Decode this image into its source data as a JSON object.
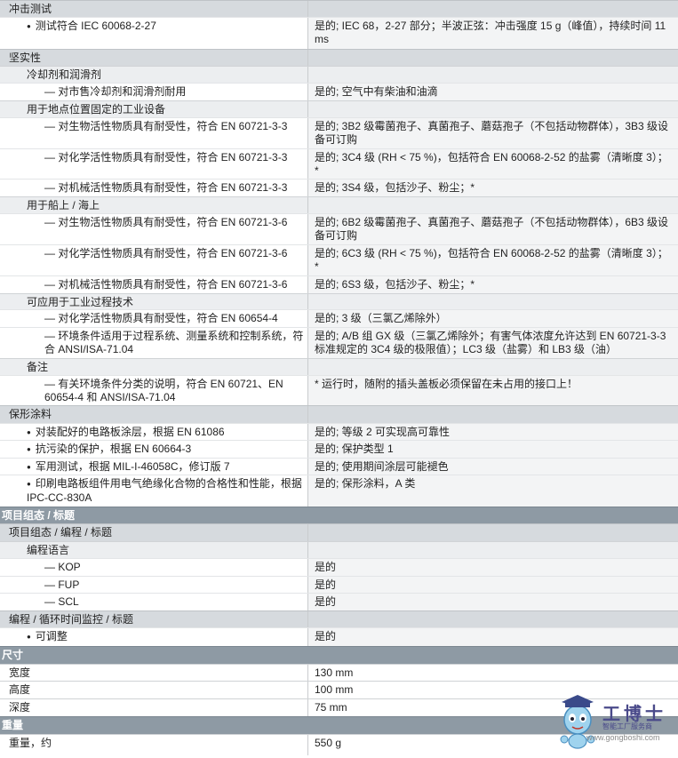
{
  "rows": [
    {
      "kind": "sec",
      "label": "冲击测试",
      "value": ""
    },
    {
      "kind": "item",
      "indent": "bul",
      "label": "测试符合 IEC 60068-2-27",
      "value": "是的; IEC 68，2-27 部分；半波正弦：冲击强度 15 g（峰值），持续时间 11 ms"
    },
    {
      "kind": "sec",
      "label": "坚实性",
      "value": ""
    },
    {
      "kind": "sub",
      "indent": "t1",
      "label": "冷却剂和润滑剂",
      "value": ""
    },
    {
      "kind": "item",
      "indent": "t2",
      "label": "— 对市售冷却剂和润滑剂耐用",
      "value": "是的; 空气中有柴油和油滴"
    },
    {
      "kind": "sub",
      "indent": "t1",
      "label": "用于地点位置固定的工业设备",
      "value": ""
    },
    {
      "kind": "item",
      "indent": "t2",
      "label": "— 对生物活性物质具有耐受性，符合 EN 60721-3-3",
      "value": "是的; 3B2 级霉菌孢子、真菌孢子、蘑菇孢子（不包括动物群体），3B3 级设备可订购"
    },
    {
      "kind": "item",
      "indent": "t2",
      "label": "— 对化学活性物质具有耐受性，符合 EN 60721-3-3",
      "value": "是的; 3C4 级 (RH < 75 %)，包括符合 EN 60068-2-52 的盐雾（清晰度 3）；*"
    },
    {
      "kind": "item",
      "indent": "t2",
      "label": "— 对机械活性物质具有耐受性，符合 EN 60721-3-3",
      "value": "是的; 3S4 级，包括沙子、粉尘；*"
    },
    {
      "kind": "sub",
      "indent": "t1",
      "label": "用于船上 / 海上",
      "value": ""
    },
    {
      "kind": "item",
      "indent": "t2",
      "label": "— 对生物活性物质具有耐受性，符合 EN 60721-3-6",
      "value": "是的; 6B2 级霉菌孢子、真菌孢子、蘑菇孢子（不包括动物群体），6B3 级设备可订购"
    },
    {
      "kind": "item",
      "indent": "t2",
      "label": "— 对化学活性物质具有耐受性，符合 EN 60721-3-6",
      "value": "是的; 6C3 级 (RH < 75 %)，包括符合 EN 60068-2-52 的盐雾（清晰度 3）；*"
    },
    {
      "kind": "item",
      "indent": "t2",
      "label": "— 对机械活性物质具有耐受性，符合 EN 60721-3-6",
      "value": "是的; 6S3 级，包括沙子、粉尘；*"
    },
    {
      "kind": "sub",
      "indent": "t1",
      "label": "可应用于工业过程技术",
      "value": ""
    },
    {
      "kind": "item",
      "indent": "t2",
      "label": "— 对化学活性物质具有耐受性，符合 EN 60654-4",
      "value": "是的; 3 级（三氯乙烯除外）"
    },
    {
      "kind": "item",
      "indent": "t2",
      "label": "— 环境条件适用于过程系统、测量系统和控制系统，符合 ANSI/ISA-71.04",
      "value": "是的; A/B 组 GX 级（三氯乙烯除外；有害气体浓度允许达到 EN 60721-3-3 标准规定的 3C4 级的极限值）；LC3 级（盐雾）和 LB3 级（油）"
    },
    {
      "kind": "sub",
      "indent": "t1",
      "label": "备注",
      "value": ""
    },
    {
      "kind": "item",
      "indent": "t2",
      "label": "— 有关环境条件分类的说明，符合 EN 60721、EN 60654-4 和 ANSI/ISA-71.04",
      "value": "* 运行时，随附的插头盖板必须保留在未占用的接口上！"
    },
    {
      "kind": "sec",
      "label": "保形涂料",
      "value": ""
    },
    {
      "kind": "item",
      "indent": "bul",
      "label": "对装配好的电路板涂层，根据 EN 61086",
      "value": "是的; 等级 2 可实现高可靠性"
    },
    {
      "kind": "item",
      "indent": "bul",
      "label": "抗污染的保护，根据 EN 60664-3",
      "value": "是的; 保护类型 1"
    },
    {
      "kind": "item",
      "indent": "bul",
      "label": "军用测试，根据 MIL-I-46058C，修订版 7",
      "value": "是的; 使用期间涂层可能褪色"
    },
    {
      "kind": "item",
      "indent": "bul",
      "label": "印刷电路板组件用电气绝缘化合物的合格性和性能，根据 IPC-CC-830A",
      "value": "是的; 保形涂料，A 类"
    },
    {
      "kind": "bar",
      "label": "项目组态 / 标题",
      "value": ""
    },
    {
      "kind": "sec",
      "label": "项目组态 / 编程 / 标题",
      "value": ""
    },
    {
      "kind": "sub",
      "indent": "t1",
      "label": "编程语言",
      "value": ""
    },
    {
      "kind": "item",
      "indent": "t2",
      "label": "— KOP",
      "value": "是的"
    },
    {
      "kind": "item",
      "indent": "t2",
      "label": "— FUP",
      "value": "是的"
    },
    {
      "kind": "item",
      "indent": "t2",
      "label": "— SCL",
      "value": "是的"
    },
    {
      "kind": "sec",
      "label": "编程 / 循环时间监控 / 标题",
      "value": ""
    },
    {
      "kind": "item",
      "indent": "bul",
      "label": "可调整",
      "value": "是的"
    },
    {
      "kind": "bar",
      "label": "尺寸",
      "value": ""
    },
    {
      "kind": "plain",
      "label": "宽度",
      "value": "130 mm"
    },
    {
      "kind": "plain",
      "label": "高度",
      "value": "100 mm"
    },
    {
      "kind": "plain",
      "label": "深度",
      "value": "75 mm"
    },
    {
      "kind": "bar",
      "label": "重量",
      "value": ""
    },
    {
      "kind": "plain",
      "label": "重量，约",
      "value": "550 g"
    }
  ],
  "watermark": {
    "brand": "工博士",
    "tagline": "智能工厂服务商",
    "url": "www.gongboshi.com"
  }
}
